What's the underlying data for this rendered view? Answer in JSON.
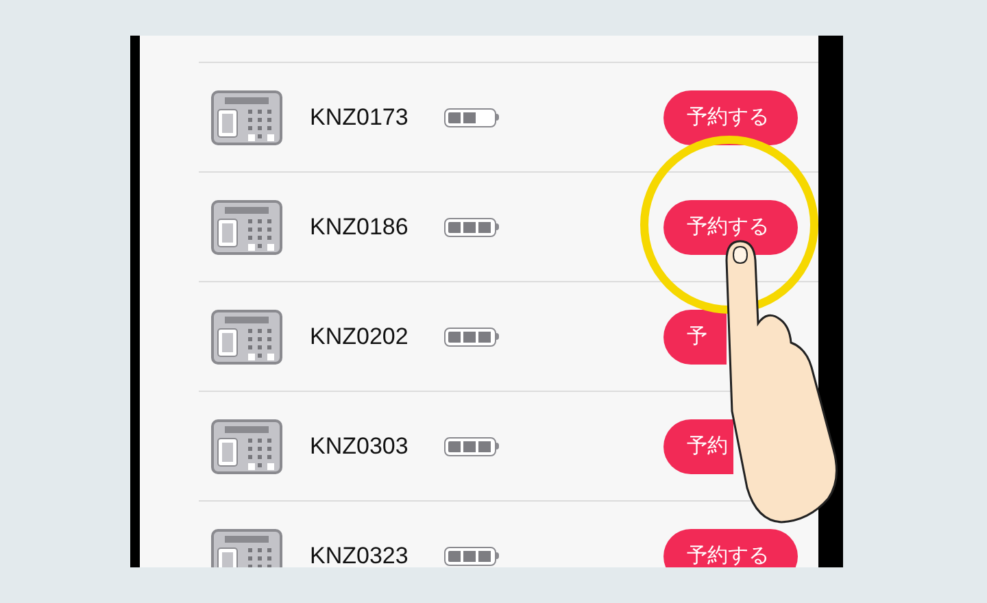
{
  "devices": [
    {
      "id": "KNZ0173",
      "battery": {
        "level": 0.67
      },
      "button": {
        "label": "予約する",
        "covered": false
      }
    },
    {
      "id": "KNZ0186",
      "battery": {
        "level": 1
      },
      "button": {
        "label": "予約する",
        "covered": false
      }
    },
    {
      "id": "KNZ0202",
      "battery": {
        "level": 1
      },
      "button": {
        "label": "予",
        "covered": true
      }
    },
    {
      "id": "KNZ0303",
      "battery": {
        "level": 1
      },
      "button": {
        "label": "予約",
        "covered": true
      }
    },
    {
      "id": "KNZ0323",
      "battery": {
        "level": 1
      },
      "button": {
        "label": "予約する",
        "covered": false
      }
    }
  ]
}
